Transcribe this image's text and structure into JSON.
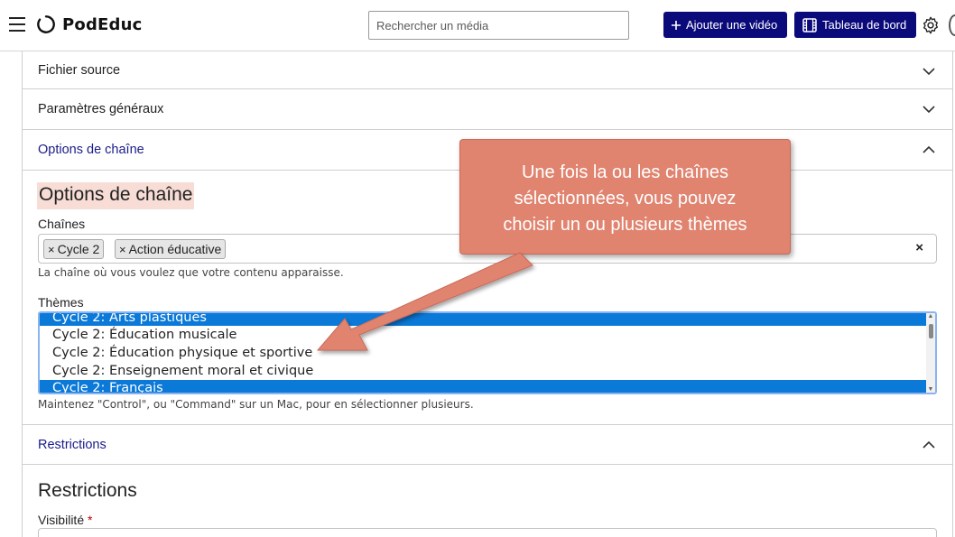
{
  "header": {
    "app_name": "PodEduc",
    "search_placeholder": "Rechercher un média",
    "add_video_label": "Ajouter une vidéo",
    "dashboard_label": "Tableau de bord"
  },
  "accordion": {
    "fichier_source": "Fichier source",
    "parametres_generaux": "Paramètres généraux",
    "options_chaine": "Options de chaîne",
    "restrictions": "Restrictions"
  },
  "options": {
    "section_title": "Options de chaîne",
    "chaines_label": "Chaînes",
    "tags": [
      "Cycle 2",
      "Action éducative"
    ],
    "tag_remove_glyph": "×",
    "clear_glyph": "×",
    "chaines_help": "La chaîne où vous voulez que votre contenu apparaisse.",
    "themes_label": "Thèmes",
    "themes": [
      {
        "label": "Cycle 2: Arts plastiques",
        "selected": true
      },
      {
        "label": "Cycle 2: Éducation musicale",
        "selected": false
      },
      {
        "label": "Cycle 2: Éducation physique et sportive",
        "selected": false
      },
      {
        "label": "Cycle 2: Enseignement moral et civique",
        "selected": false
      },
      {
        "label": "Cycle 2: Français",
        "selected": true
      }
    ],
    "themes_help": "Maintenez \"Control\", ou \"Command\" sur un Mac, pour en sélectionner plusieurs."
  },
  "restrictions": {
    "title": "Restrictions",
    "visibility_label": "Visibilité",
    "required_mark": "*"
  },
  "annotation": {
    "text_line1": "Une fois la ou les chaînes",
    "text_line2": "sélectionnées, vous pouvez",
    "text_line3": "choisir un ou plusieurs thèmes"
  },
  "colors": {
    "brand_navy": "#0a0a7a",
    "selection_blue": "#0a79d8",
    "callout_salmon": "#e08470",
    "title_highlight": "#f7ddd6"
  },
  "icons": {
    "menu": "hamburger-icon",
    "logo": "podeduc-logo-icon",
    "add": "plus-icon",
    "dashboard": "film-icon",
    "settings": "gear-icon",
    "collapse": "chevron-up-icon",
    "expand": "chevron-down-icon"
  }
}
